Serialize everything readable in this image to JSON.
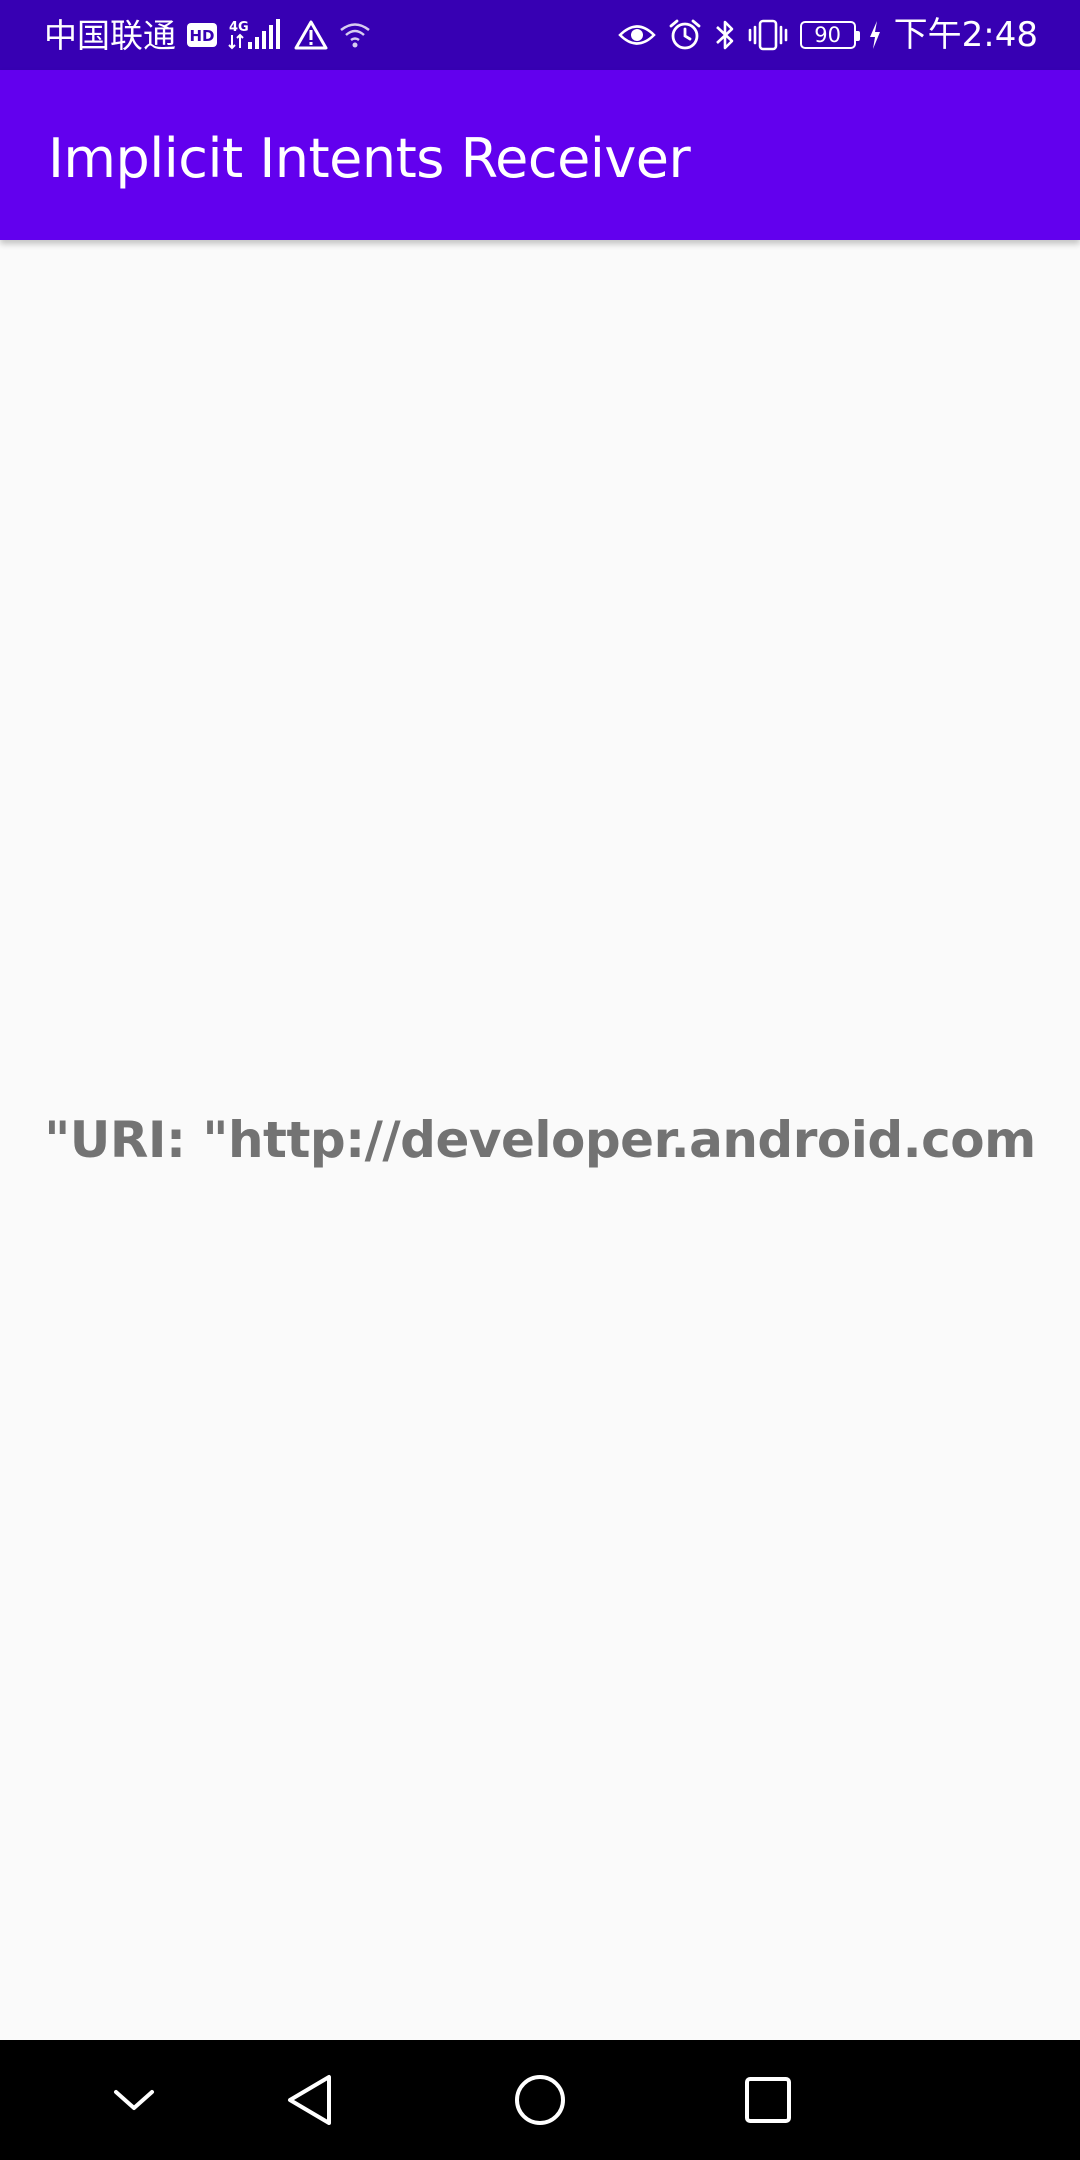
{
  "status_bar": {
    "carrier": "中国联通",
    "network": "4G",
    "battery_level": "90",
    "time": "下午2:48",
    "icons": [
      "hd-icon",
      "signal-icon",
      "warning-icon",
      "wifi-icon",
      "eye-icon",
      "alarm-icon",
      "bluetooth-icon",
      "vibrate-icon",
      "battery-icon",
      "charging-icon"
    ]
  },
  "app_bar": {
    "title": "Implicit Intents Receiver"
  },
  "main": {
    "uri_text": "\"URI: \"http://developer.android.com"
  },
  "nav_bar": {
    "buttons": [
      "collapse",
      "back",
      "home",
      "recents"
    ]
  },
  "colors": {
    "status_bar": "#3700b3",
    "app_bar": "#6200ee",
    "background": "#fafafa",
    "text": "#737373",
    "nav_bar": "#000000"
  }
}
